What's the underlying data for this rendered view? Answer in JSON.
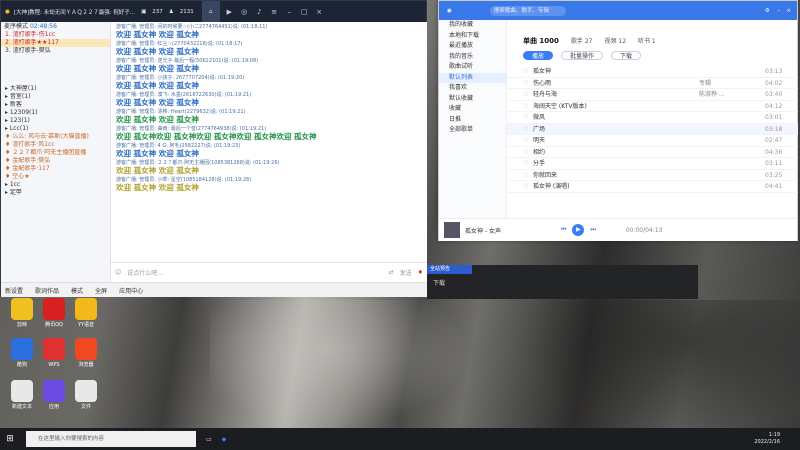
{
  "yy": {
    "title": "[大神]教程: 永劫无间ＹＡＱ２２７最强: 祝好子...",
    "stat1": "237",
    "stat2": "2131",
    "timer": "02:48:56",
    "left_header": "麦序模式",
    "left_top": [
      "1. 渣打歌手-伤1cc",
      "2. 渣打歌手★★117",
      "3. 渣打歌手-樊弘"
    ],
    "channels": [
      "大神屋(1)",
      "音室(1)",
      "新客",
      "12309(1)",
      "123(1)",
      "Lcc(1)"
    ],
    "members": [
      "么么: 风与云·慕斯(大猫直播)",
      "渣打歌手·风1cc",
      "２２７都爪·阿无主播团直播",
      "金配歌手·樊弘",
      "金配歌手·117",
      "空心★"
    ],
    "channels2": [
      "1cc",
      "定甲"
    ],
    "messages": [
      {
        "meta": "游客广播: 管理员: 闲的时候要☆(小二2774764451)说: (01:18:11)",
        "text": "欢迎 孤女神 欢迎 孤女神",
        "c": 0
      },
      {
        "meta": "游客广播: 管理员: 红尘☆(2770432218)说: (01:18:17)",
        "text": "欢迎 孤女神 欢迎 孤女神",
        "c": 0
      },
      {
        "meta": "游客广播: 管理员: 逆光子·最后一程(50622101)说: (01:19:08)",
        "text": "欢迎 孤女神 欢迎 孤女神",
        "c": 0
      },
      {
        "meta": "游客广播: 管理员: 小孩子: 2677707204)说: (01:19:20)",
        "text": "欢迎 孤女神 欢迎 孤女神",
        "c": 0
      },
      {
        "meta": "游客广播: 管理员: 漠飞: 水墨(2616722630)说: (01:19:21)",
        "text": "欢迎 孤女神 欢迎 孤女神",
        "c": 0
      },
      {
        "meta": "游客广播: 管理员: 漂移: Heart(2279632)说: (01:19:21)",
        "text": "欢迎 孤女神 欢迎 孤女神",
        "c": 1
      },
      {
        "meta": "游客广播: 管理员: 曲雨: 最后一个音(2774764938)说: (01:19:21)",
        "text": "欢迎 孤女神欢迎 孤女神欢迎 孤女神欢迎 孤女神欢迎 孤女神",
        "c": 1
      },
      {
        "meta": "游客广播: 管理员: 4 G: 阿毛(2582227)说: (01:19:23)",
        "text": "欢迎 孤女神 欢迎 孤女神",
        "c": 0
      },
      {
        "meta": "游客广播: 管理员: ２２７都爪·阿无主播团(1085381268)说: (01:19:26)",
        "text": "欢迎 孤女神 欢迎 孤女神",
        "c": 2
      },
      {
        "meta": "游客广播: 管理员: 小乖: 星空(1085184128)说: (01:19:28)",
        "text": "欢迎 孤女神 欢迎 孤女神",
        "c": 2
      }
    ],
    "input_placeholder": "说点什么吧...",
    "send_label": "发送",
    "bottom_items": [
      "新设置",
      "歌词作品",
      "模式",
      "全屏",
      "应用中心"
    ]
  },
  "music": {
    "search_placeholder": "搜索歌曲、歌手、专辑",
    "sidebar": [
      "我的收藏",
      "本地和下载",
      "最近播放",
      "我的音乐",
      "歌曲试听",
      "默认列表",
      "我喜欢",
      "默认收藏",
      "收藏",
      "日推",
      "全部歌单"
    ],
    "active_sidebar": 5,
    "tabs": [
      "单曲 1000",
      "歌手 27",
      "视频 12",
      "听书 1"
    ],
    "actions": [
      "播放",
      "批量操作",
      "下载"
    ],
    "songs": [
      {
        "name": "孤女神",
        "artist": "",
        "album": "",
        "dur": "03:13"
      },
      {
        "name": "伤心雨",
        "artist": "",
        "album": "专辑",
        "dur": "04:02"
      },
      {
        "name": "轻舟与海",
        "artist": "",
        "album": "陈淑桦·...",
        "dur": "03:40"
      },
      {
        "name": "海阔天空 (KTV版本)",
        "artist": "",
        "album": "",
        "dur": "04:12"
      },
      {
        "name": "微风",
        "artist": "",
        "album": "",
        "dur": "03:01"
      },
      {
        "name": "广场",
        "artist": "",
        "album": "",
        "dur": "03:18"
      },
      {
        "name": "明天",
        "artist": "",
        "album": "",
        "dur": "02:47"
      },
      {
        "name": "相约",
        "artist": "",
        "album": "",
        "dur": "04:36"
      },
      {
        "name": "分手",
        "artist": "",
        "album": "",
        "dur": "03:11"
      },
      {
        "name": "你就回来",
        "artist": "",
        "album": "",
        "dur": "03:25"
      },
      {
        "name": "孤女神 (演唱)",
        "artist": "",
        "album": "",
        "dur": "04:41"
      }
    ],
    "player_title": "孤女神 - 女声",
    "player_time": "00:00/04:13"
  },
  "video": {
    "label": "全站预告",
    "bottom": "下载"
  },
  "taskbar": {
    "search": "在这里输入你要搜索的内容",
    "time": "1:19",
    "date": "2022/2/16"
  },
  "desktop_icons": [
    {
      "label": "剪映",
      "color": "#f0c020"
    },
    {
      "label": "腾讯QQ",
      "color": "#d82020"
    },
    {
      "label": "YY语音",
      "color": "#f5b81a"
    },
    {
      "label": "酷狗",
      "color": "#2c6fe0"
    },
    {
      "label": "WPS",
      "color": "#e03030"
    },
    {
      "label": "浏览器",
      "color": "#f04820"
    },
    {
      "label": "新建文本",
      "color": "#e8e8e8"
    },
    {
      "label": "应用",
      "color": "#6c4ce0"
    },
    {
      "label": "文件",
      "color": "#e8e8e8"
    }
  ]
}
